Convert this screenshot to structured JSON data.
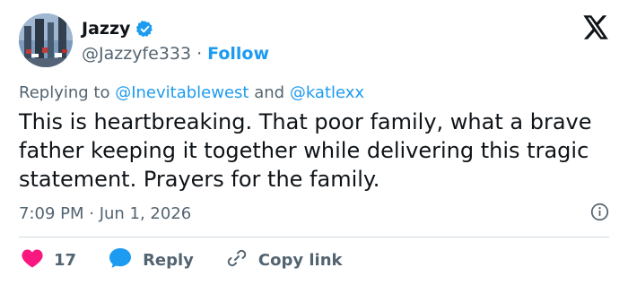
{
  "author": {
    "display_name": "Jazzy",
    "handle": "@Jazzyfe333",
    "separator": "·",
    "follow_label": "Follow",
    "verified": true
  },
  "reply": {
    "prefix": "Replying to",
    "mentions": [
      "@Inevitablewest",
      "@katlexx"
    ],
    "conjunction": "and"
  },
  "tweet": {
    "text": "This is heartbreaking. That poor family, what a brave father keeping it together while delivering this tragic statement. Prayers for the family.",
    "timestamp": "7:09 PM · Jun 1, 2026"
  },
  "actions": {
    "like_count": "17",
    "reply_label": "Reply",
    "copy_link_label": "Copy link"
  },
  "colors": {
    "accent": "#1d9bf0",
    "like": "#f91880",
    "muted": "#536471",
    "text": "#0f1419"
  },
  "icons": [
    "x-logo-icon",
    "verified-badge-icon",
    "info-icon",
    "heart-icon",
    "reply-bubble-icon",
    "link-icon"
  ]
}
